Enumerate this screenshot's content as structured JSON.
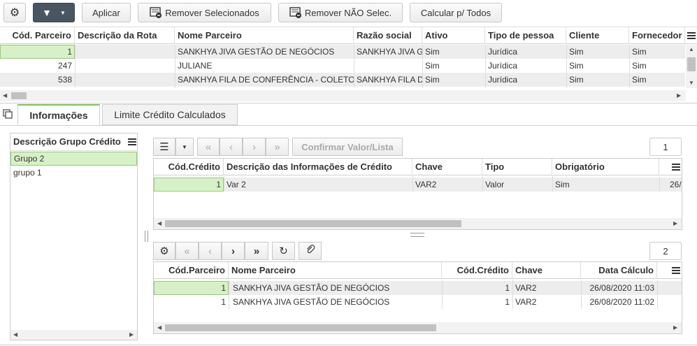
{
  "toolbar": {
    "apply_label": "Aplicar",
    "remove_selected_label": "Remover Selecionados",
    "remove_not_selected_label": "Remover NÃO Selec.",
    "calculate_all_label": "Calcular p/ Todos"
  },
  "partners_grid": {
    "columns": [
      "Cód. Parceiro",
      "Descrição da Rota",
      "Nome Parceiro",
      "Razão social",
      "Ativo",
      "Tipo de pessoa",
      "Cliente",
      "Fornecedor"
    ],
    "rows": [
      [
        "1",
        "",
        "SANKHYA JIVA GESTÃO DE NEGÓCIOS",
        "SANKHYA JIVA G",
        "Sim",
        "Jurídica",
        "Sim",
        "Sim"
      ],
      [
        "247",
        "",
        "JULIANE",
        "",
        "Sim",
        "Jurídica",
        "Sim",
        "Sim"
      ],
      [
        "538",
        "",
        "SANKHYA FILA DE CONFERÊNCIA - COLETO",
        "SANKHYA FILA D",
        "Sim",
        "Jurídica",
        "Sim",
        "Sim"
      ]
    ]
  },
  "tabs": {
    "info_label": "Informações",
    "limit_label": "Limite Crédito Calculados"
  },
  "group_grid": {
    "header": "Descrição Grupo Crédito",
    "rows": [
      "Grupo 2",
      "grupo 1"
    ]
  },
  "info_grid": {
    "confirm_label": "Confirmar Valor/Lista",
    "page": "1",
    "columns": [
      "Cód.Crédito",
      "Descrição das Informações de Crédito",
      "Chave",
      "Tipo",
      "Obrigatório"
    ],
    "rows": [
      [
        "1",
        "Var 2",
        "VAR2",
        "Valor",
        "Sim",
        "26/"
      ]
    ]
  },
  "calc_grid": {
    "page": "2",
    "columns": [
      "Cód.Parceiro",
      "Nome Parceiro",
      "Cód.Crédito",
      "Chave",
      "Data Cálculo"
    ],
    "rows": [
      [
        "1",
        "SANKHYA JIVA GESTÃO DE NEGÓCIOS",
        "1",
        "VAR2",
        "26/08/2020 11:03"
      ],
      [
        "1",
        "SANKHYA JIVA GESTÃO DE NEGÓCIOS",
        "1",
        "VAR2",
        "26/08/2020 11:02"
      ]
    ]
  }
}
